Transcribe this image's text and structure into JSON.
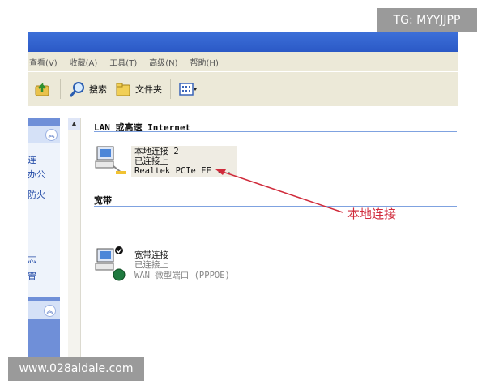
{
  "menu": {
    "items": [
      "查看(V)",
      "收藏(A)",
      "工具(T)",
      "高级(N)",
      "帮助(H)"
    ]
  },
  "toolbar": {
    "search_label": "搜索",
    "folders_label": "文件夹"
  },
  "sidebar": {
    "items": [
      "连",
      "办公",
      "防火",
      "志",
      "置"
    ]
  },
  "groups": [
    {
      "heading": "LAN 或高速 Internet",
      "connection": {
        "name": "本地连接 2",
        "status": "已连接上",
        "device": "Realtek PCIe FE ..."
      }
    },
    {
      "heading": "宽带",
      "connection": {
        "name": "宽带连接",
        "status": "已连接上",
        "device": "WAN 微型端口 (PPPOE)"
      }
    }
  ],
  "annotation": {
    "label": "本地连接"
  },
  "watermarks": {
    "top_right": "TG: MYYJJPP",
    "bottom_left": "www.028aldale.com"
  },
  "colors": {
    "annotation": "#d02b3b",
    "sidebar_text": "#2149a6",
    "group_rule": "#7fa2e0",
    "watermark_bg": "#9a9a9a"
  },
  "icons": [
    "up-folder-icon",
    "search-icon",
    "folders-icon",
    "views-icon",
    "network-connection-icon",
    "broadband-connection-icon",
    "collapse-icon",
    "scroll-up-icon"
  ]
}
